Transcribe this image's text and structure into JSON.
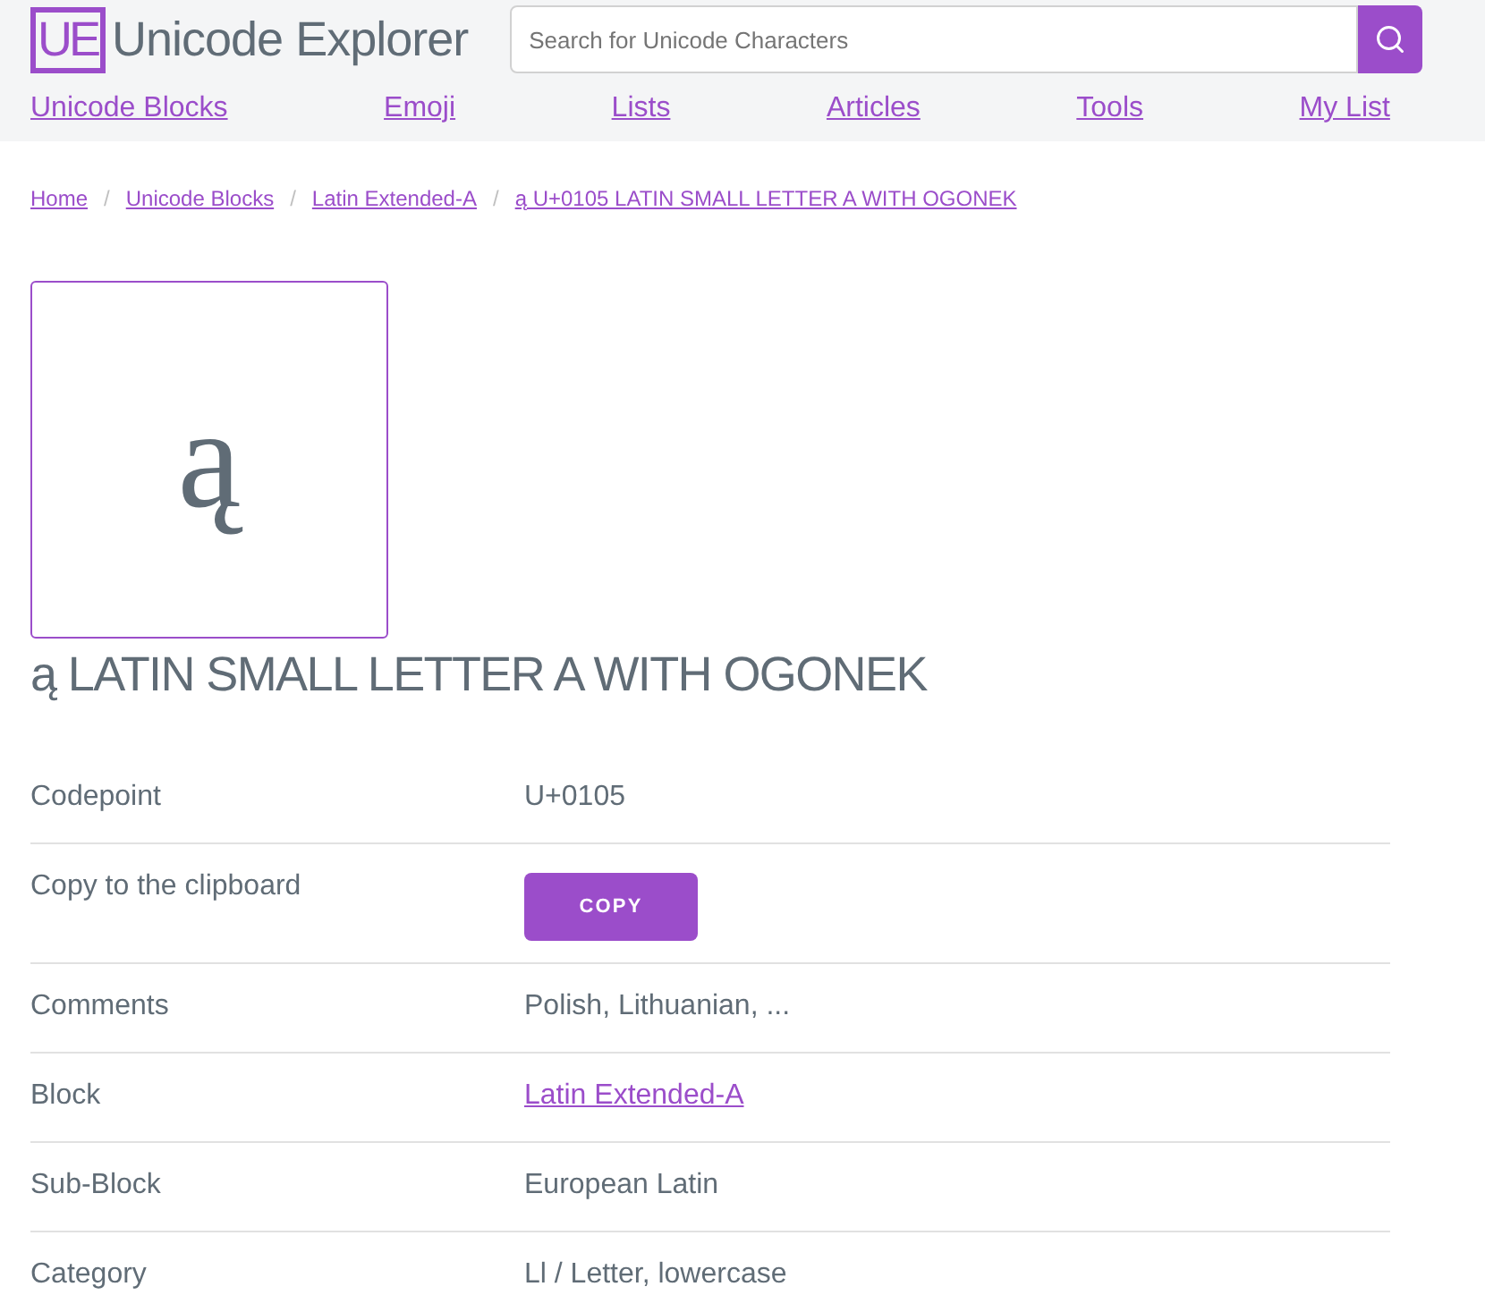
{
  "logo": {
    "mark": "UE",
    "title": "Unicode Explorer"
  },
  "search": {
    "placeholder": "Search for Unicode Characters"
  },
  "nav": [
    "Unicode Blocks",
    "Emoji",
    "Lists",
    "Articles",
    "Tools",
    "My List"
  ],
  "breadcrumb_separator": "/",
  "breadcrumb": [
    "Home",
    "Unicode Blocks",
    "Latin Extended-A",
    "ą U+0105 LATIN SMALL LETTER A WITH OGONEK"
  ],
  "glyph": "ą",
  "heading": "ą LATIN SMALL LETTER A WITH OGONEK",
  "rows": [
    {
      "label": "Codepoint",
      "kind": "text",
      "value": "U+0105"
    },
    {
      "label": "Copy to the clipboard",
      "kind": "button",
      "value": "COPY"
    },
    {
      "label": "Comments",
      "kind": "text",
      "value": "Polish, Lithuanian, ..."
    },
    {
      "label": "Block",
      "kind": "link",
      "value": "Latin Extended-A"
    },
    {
      "label": "Sub-Block",
      "kind": "text",
      "value": "European Latin"
    },
    {
      "label": "Category",
      "kind": "text",
      "value": "Ll / Letter, lowercase"
    }
  ]
}
